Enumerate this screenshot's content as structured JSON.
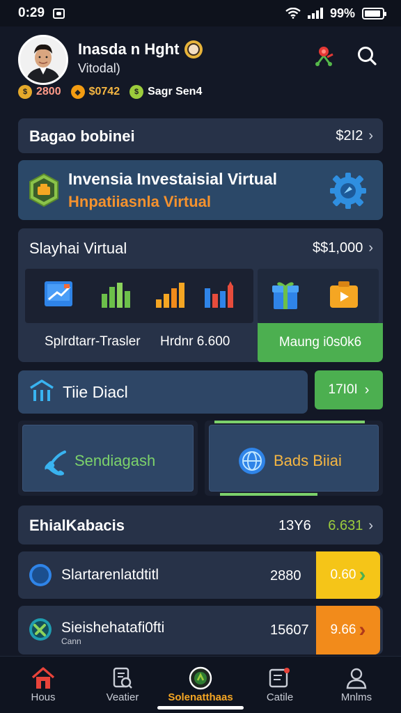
{
  "status_bar": {
    "time": "0:29",
    "battery": "99%"
  },
  "profile": {
    "name": "Inasda n Hght",
    "subtitle": "Vitodal)",
    "stats": [
      {
        "icon": "coin-icon",
        "value": "2800"
      },
      {
        "icon": "gem-icon",
        "value": "$0742"
      },
      {
        "icon": "green-coin-icon",
        "value": "Sagr Sen4"
      }
    ]
  },
  "rows": {
    "balance": {
      "title": "Bagao bobinei",
      "value": "$2I2"
    },
    "investment": {
      "title": "Invensia Investaisial Virtual",
      "subtitle": "Hnpatiiasnla Virtual"
    },
    "virtual": {
      "title": "Slayhai Virtual",
      "value": "$$1,000"
    },
    "tools": [
      {
        "icon": "presentation-chart-icon"
      },
      {
        "icon": "bar-chart-icon"
      },
      {
        "icon": "growth-bars-icon"
      },
      {
        "icon": "analytics-chart-icon"
      }
    ],
    "tool_labels": {
      "left": "Splrdtarr-Trasler",
      "middle": "Hrdnr 6.600"
    },
    "side_tools": [
      {
        "icon": "gift-box-icon"
      },
      {
        "icon": "wallet-icon"
      }
    ],
    "green_button": "Maung i0s0k6",
    "title_card": {
      "title": "Tiie Diacl",
      "value": "17I0I"
    },
    "actions": {
      "left": "Sendiagash",
      "right": "Bads Biiai"
    },
    "list_header": {
      "title": "EhialKabacis",
      "count": "13Y6",
      "value": "6.631"
    },
    "list": [
      {
        "label": "Slartarenlatdtitl",
        "sub": "",
        "value": "2880",
        "badge": "0.60"
      },
      {
        "label": "Sieishehatafi0fti",
        "sub": "Cann",
        "value": "15607",
        "badge": "9.66"
      }
    ]
  },
  "nav": [
    {
      "label": "Hous",
      "icon": "home-icon",
      "active": false
    },
    {
      "label": "Veatier",
      "icon": "receipt-icon",
      "active": false
    },
    {
      "label": "Solenatthaas",
      "icon": "target-icon",
      "active": true
    },
    {
      "label": "Catile",
      "icon": "document-icon",
      "active": false
    },
    {
      "label": "Mnlms",
      "icon": "user-icon",
      "active": false
    }
  ],
  "colors": {
    "background": "#131826",
    "card": "#273248",
    "accent_green": "#4caf50",
    "accent_orange": "#f28b1b",
    "accent_yellow": "#f5c518"
  }
}
